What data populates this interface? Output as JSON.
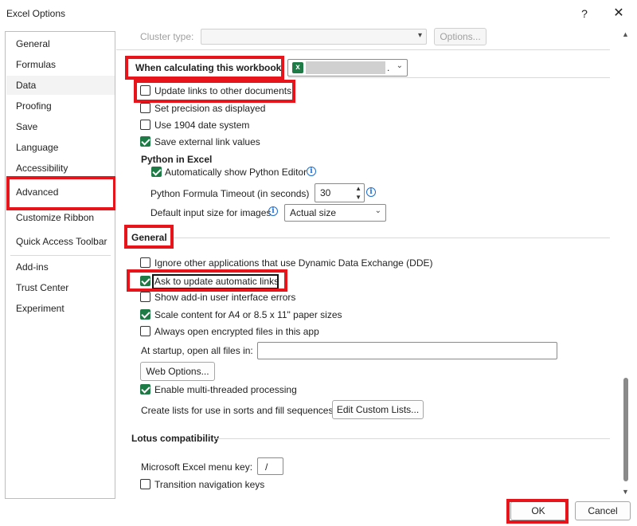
{
  "window": {
    "title": "Excel Options",
    "help": "?",
    "close": "✕"
  },
  "sidebar": {
    "items": [
      {
        "label": "General"
      },
      {
        "label": "Formulas"
      },
      {
        "label": "Data"
      },
      {
        "label": "Proofing"
      },
      {
        "label": "Save"
      },
      {
        "label": "Language"
      },
      {
        "label": "Accessibility"
      },
      {
        "label": "Advanced"
      },
      {
        "label": "Customize Ribbon"
      },
      {
        "label": "Quick Access Toolbar"
      },
      {
        "label": "Add-ins"
      },
      {
        "label": "Trust Center"
      },
      {
        "label": "Experiment"
      }
    ],
    "selected": "Data"
  },
  "top": {
    "cluster_type_label": "Cluster type:",
    "options_button": "Options..."
  },
  "calc": {
    "heading": "When calculating this workbook:",
    "workbook_suffix": ".",
    "update_links": "Update links to other documents",
    "set_precision": "Set precision as displayed",
    "use_1904": "Use 1904 date system",
    "save_external": "Save external link values"
  },
  "python": {
    "heading": "Python in Excel",
    "auto_show_editor": "Automatically show Python Editor",
    "formula_timeout_label": "Python Formula Timeout (in seconds)",
    "formula_timeout_value": "30",
    "default_input_label": "Default input size for images",
    "default_input_value": "Actual size"
  },
  "general": {
    "heading": "General",
    "ignore_dde": "Ignore other applications that use Dynamic Data Exchange (DDE)",
    "ask_update_links": "Ask to update automatic links",
    "show_addin_errors": "Show add-in user interface errors",
    "scale_content": "Scale content for A4 or 8.5 x 11\" paper sizes",
    "always_open_encrypted": "Always open encrypted files in this app",
    "startup_label": "At startup, open all files in:",
    "web_options_button": "Web Options...",
    "multi_threaded": "Enable multi-threaded processing",
    "create_lists_label": "Create lists for use in sorts and fill sequences:",
    "edit_custom_lists_button": "Edit Custom Lists..."
  },
  "lotus": {
    "heading": "Lotus compatibility",
    "menu_key_label": "Microsoft Excel menu key:",
    "menu_key_value": "/",
    "transition_nav_keys": "Transition navigation keys"
  },
  "footer": {
    "ok": "OK",
    "cancel": "Cancel"
  },
  "checkboxes": {
    "update_links": false,
    "set_precision": false,
    "use_1904": false,
    "save_external": true,
    "auto_show_editor": true,
    "ignore_dde": false,
    "ask_update_links": true,
    "show_addin_errors": false,
    "scale_content": true,
    "always_open_encrypted": false,
    "multi_threaded": true,
    "transition_nav_keys": false
  },
  "colors": {
    "highlight": "#e8141c",
    "excel_green": "#1e7b45",
    "info_blue": "#1e6fd0"
  }
}
